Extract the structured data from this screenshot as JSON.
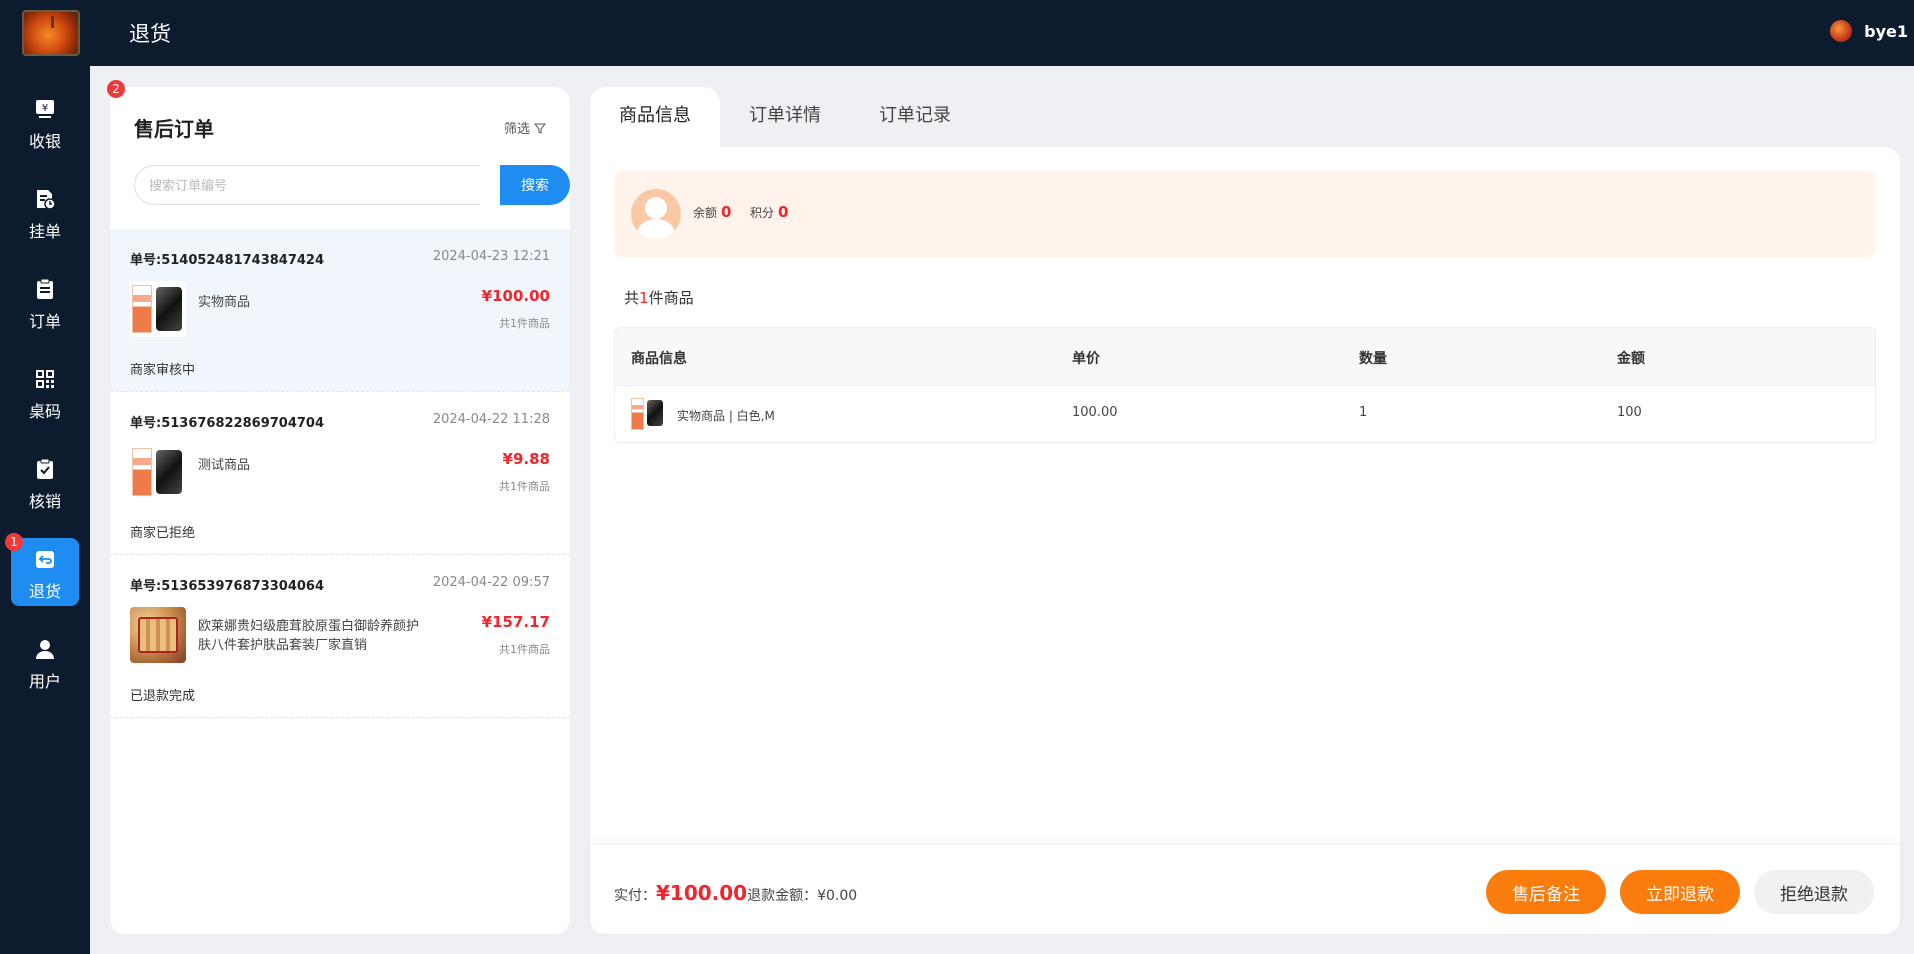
{
  "header": {
    "title": "退货",
    "username": "bye1"
  },
  "sidebar": {
    "items": [
      {
        "label": "收银"
      },
      {
        "label": "挂单"
      },
      {
        "label": "订单"
      },
      {
        "label": "桌码"
      },
      {
        "label": "核销"
      },
      {
        "label": "退货",
        "badge": "1",
        "active": true
      },
      {
        "label": "用户"
      }
    ]
  },
  "orders": {
    "badge": "2",
    "title": "售后订单",
    "filter_label": "筛选",
    "search_placeholder": "搜索订单编号",
    "search_button": "搜索",
    "list": [
      {
        "order_no": "单号:514052481743847424",
        "time": "2024-04-23 12:21",
        "goods": "实物商品",
        "price": "¥100.00",
        "count": "共1件商品",
        "status": "商家审核中"
      },
      {
        "order_no": "单号:513676822869704704",
        "time": "2024-04-22 11:28",
        "goods": "测试商品",
        "price": "¥9.88",
        "count": "共1件商品",
        "status": "商家已拒绝"
      },
      {
        "order_no": "单号:513653976873304064",
        "time": "2024-04-22 09:57",
        "goods": "欧莱娜贵妇级鹿茸胶原蛋白御龄养颜护肤八件套护肤品套装厂家直销",
        "price": "¥157.17",
        "count": "共1件商品",
        "status": "已退款完成"
      }
    ]
  },
  "detail": {
    "tabs": [
      "商品信息",
      "订单详情",
      "订单记录"
    ],
    "member": {
      "balance_label": "余额",
      "balance": "0",
      "points_label": "积分",
      "points": "0"
    },
    "goods_total": {
      "prefix": "共",
      "num": "1",
      "suffix": "件商品"
    },
    "table": {
      "headers": [
        "商品信息",
        "单价",
        "数量",
        "金额"
      ],
      "rows": [
        {
          "name": "实物商品 | 白色,M",
          "unit_price": "100.00",
          "qty": "1",
          "amount": "100"
        }
      ]
    },
    "footer": {
      "paid_label": "实付：",
      "paid_amount": "¥100.00",
      "refund_label": "退款金额：",
      "refund_amount": "¥0.00",
      "buttons": {
        "note": "售后备注",
        "refund": "立即退款",
        "reject": "拒绝退款"
      }
    }
  },
  "colors": {
    "accent_blue": "#1e8cf0",
    "accent_orange": "#f97c0c",
    "price_red": "#f0262c",
    "nav_bg": "#0d1b2e"
  }
}
